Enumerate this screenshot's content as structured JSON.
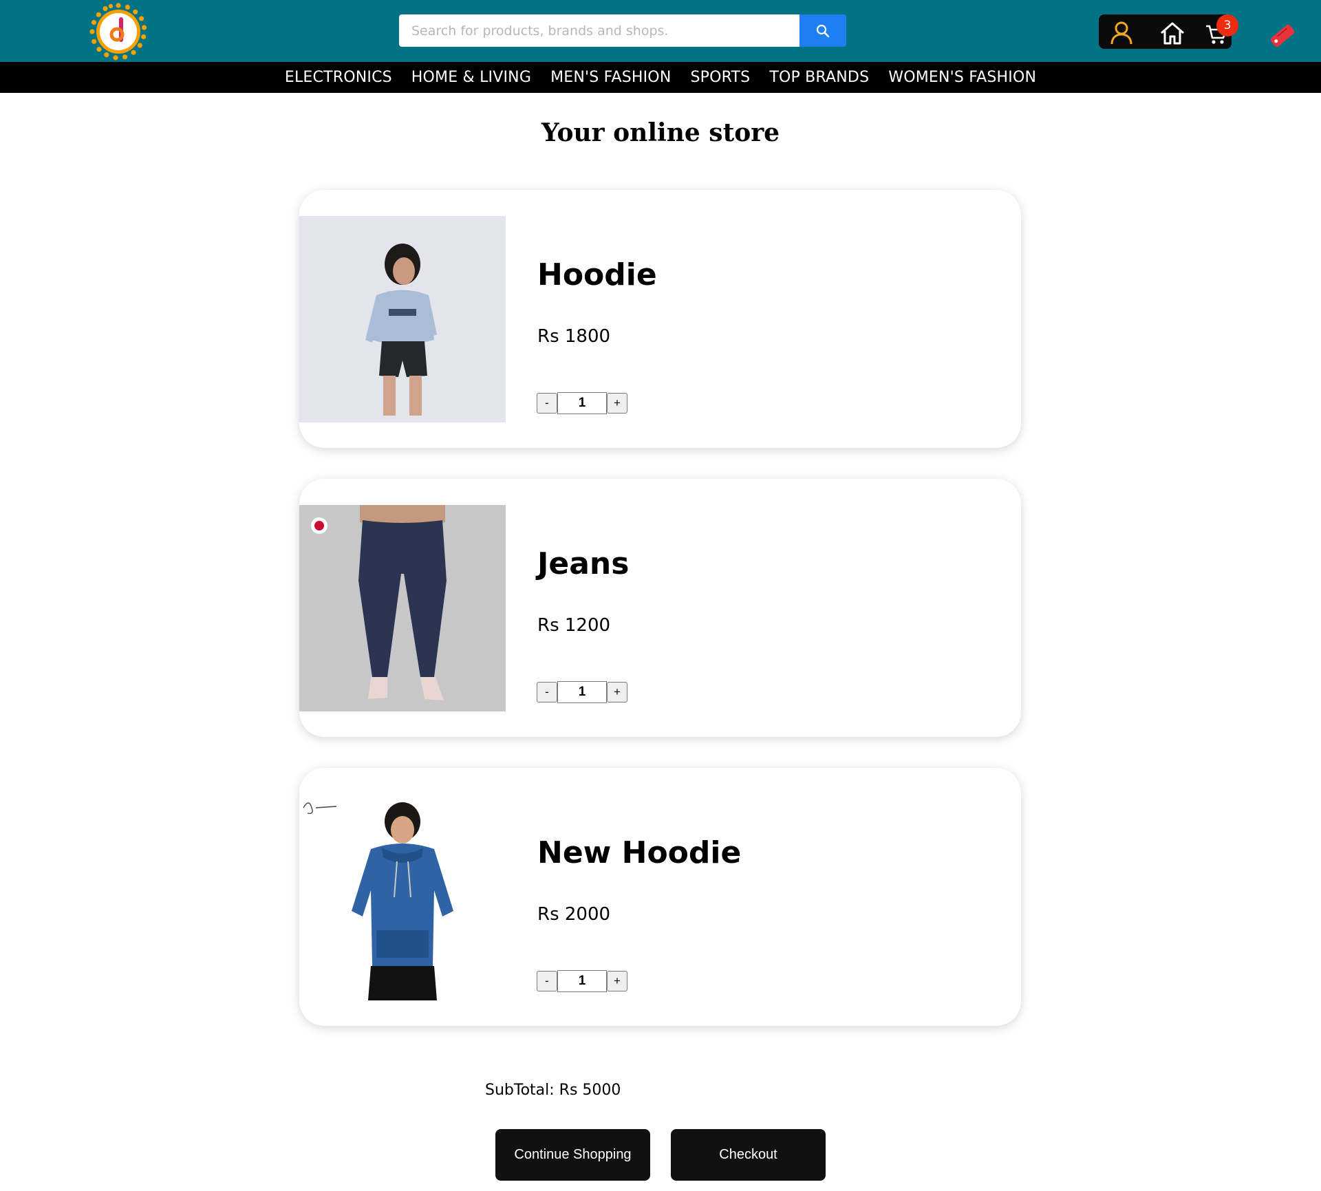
{
  "header": {
    "search_placeholder": "Search for products, brands and shops.",
    "cart_count": "3",
    "icons": [
      "user-icon",
      "home-icon",
      "cart-icon",
      "tag-icon"
    ]
  },
  "nav": {
    "items": [
      "ELECTRONICS",
      "HOME & LIVING",
      "MEN'S FASHION",
      "SPORTS",
      "TOP BRANDS",
      "WOMEN'S FASHION"
    ]
  },
  "main": {
    "title": "Your online store"
  },
  "cart": {
    "items": [
      {
        "name": "Hoodie",
        "price": "Rs 1800",
        "qty": "1",
        "minus": "-",
        "plus": "+"
      },
      {
        "name": "Jeans",
        "price": "Rs 1200",
        "qty": "1",
        "minus": "-",
        "plus": "+"
      },
      {
        "name": "New Hoodie",
        "price": "Rs 2000",
        "qty": "1",
        "minus": "-",
        "plus": "+"
      }
    ],
    "subtotal": "SubTotal: Rs 5000"
  },
  "actions": {
    "continue_label": "Continue Shopping",
    "checkout_label": "Checkout"
  },
  "colors": {
    "header_bg": "#027384",
    "nav_bg": "#000000",
    "search_button": "#1e7ff2",
    "badge": "#ee2c12",
    "user_icon": "#f5a623",
    "tag_icon": "#e8333a"
  }
}
